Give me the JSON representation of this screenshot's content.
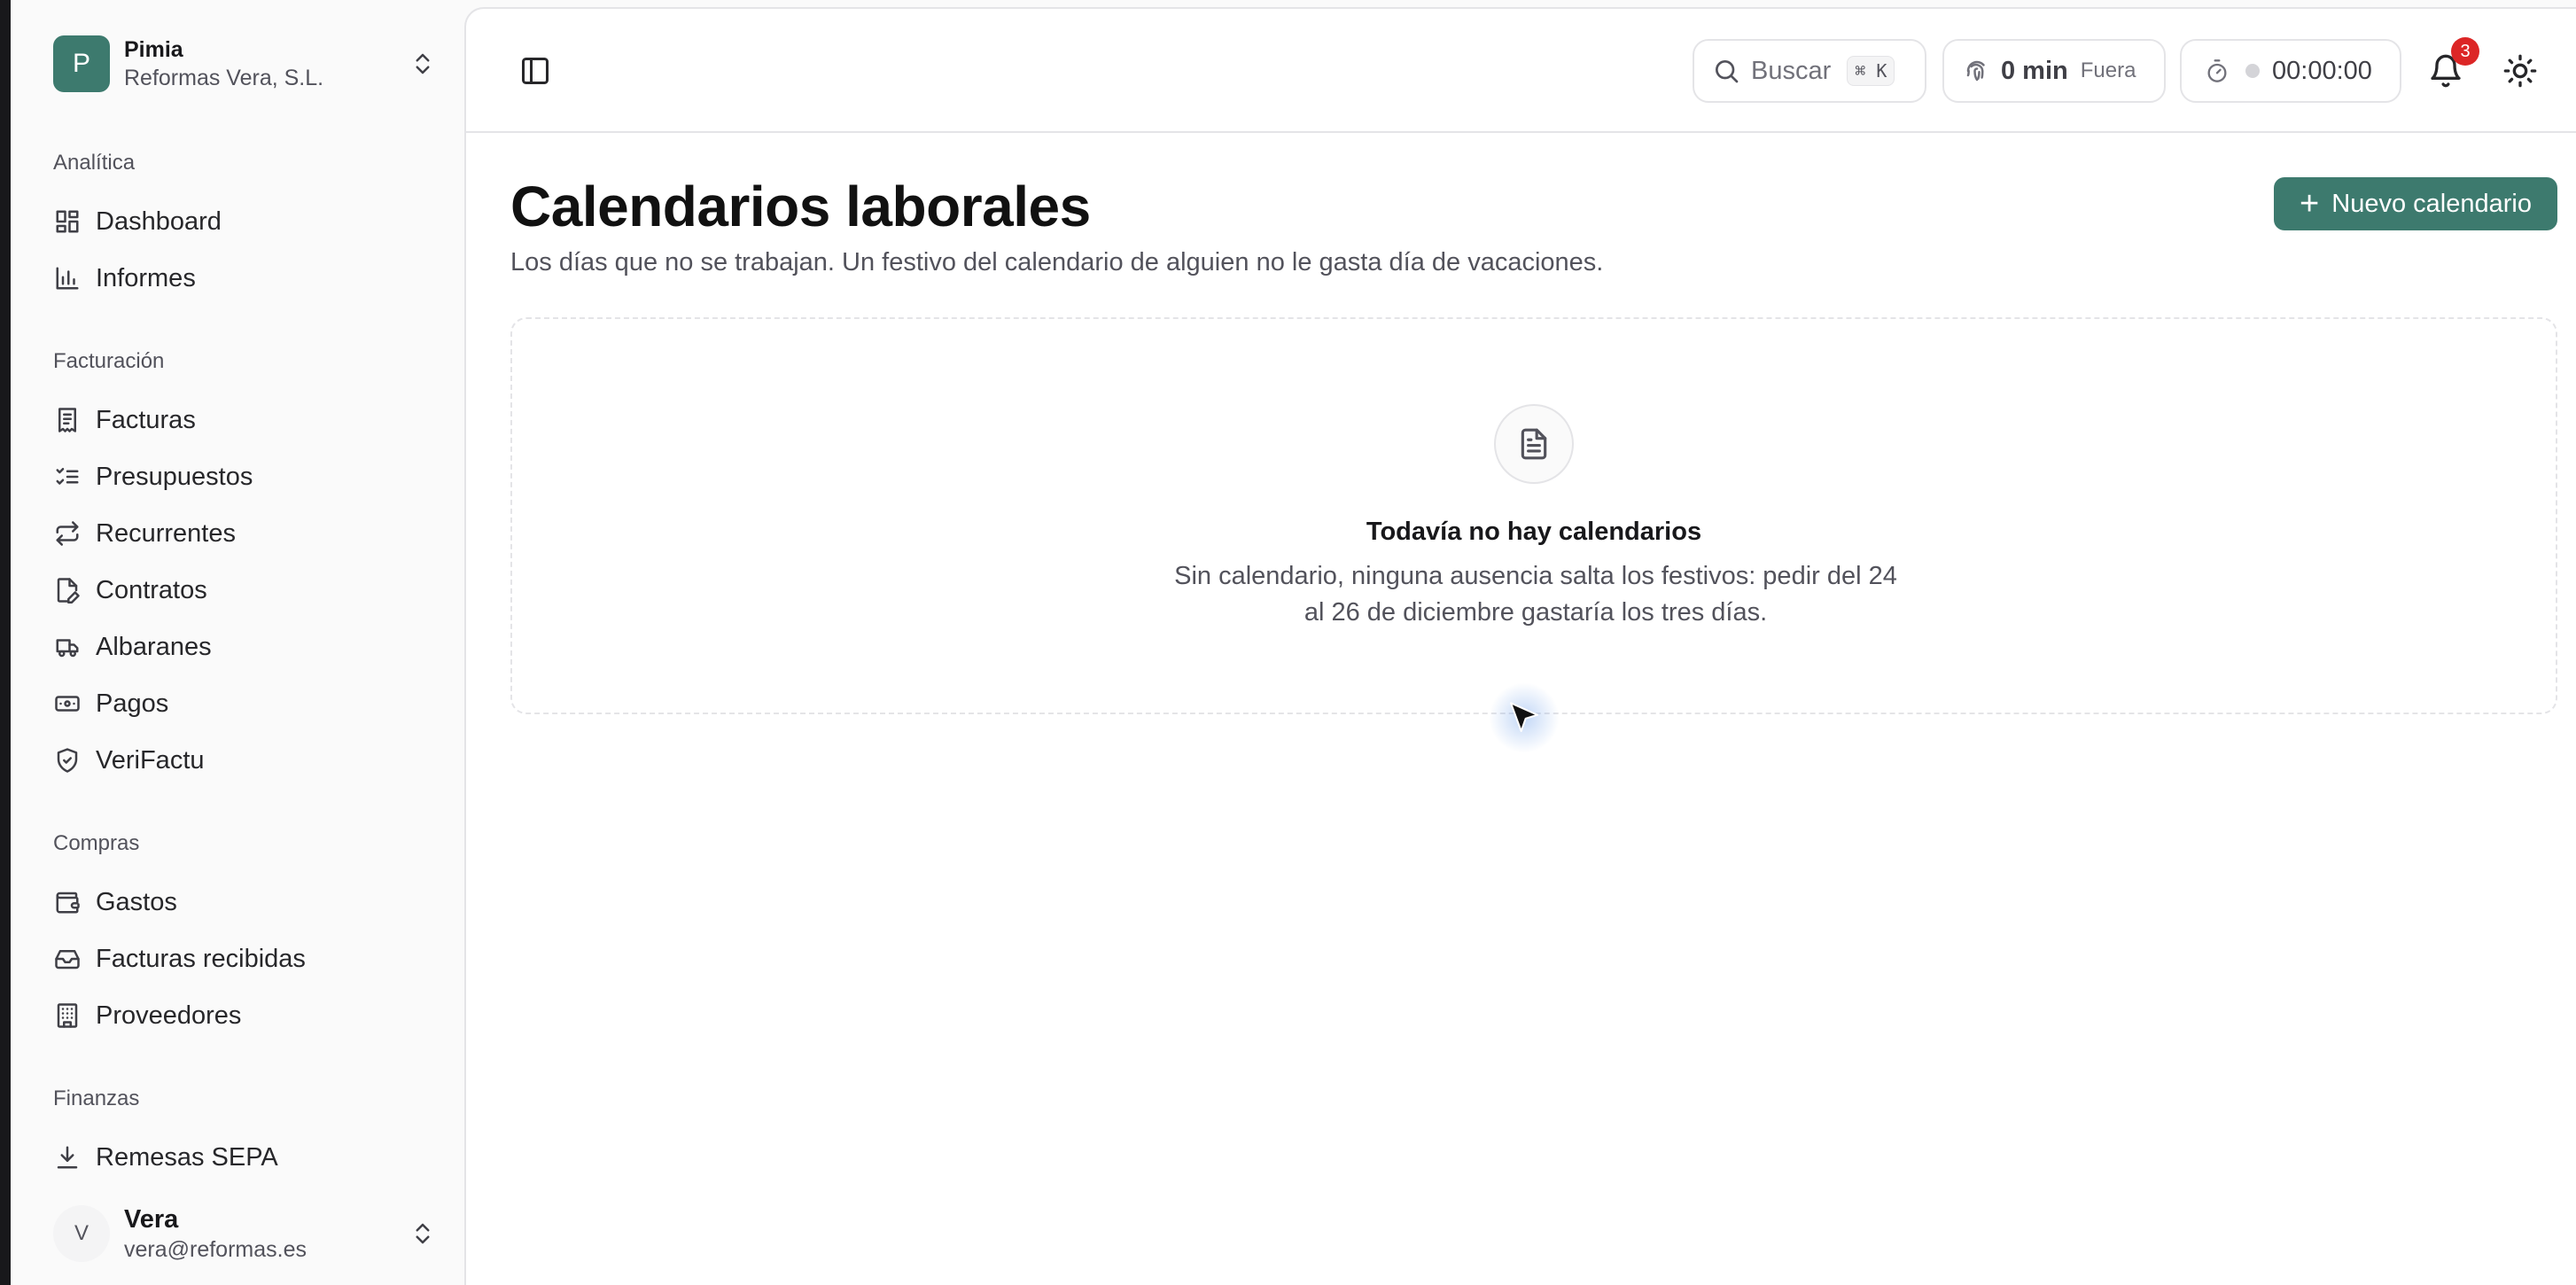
{
  "org": {
    "initial": "P",
    "name": "Pimia",
    "company": "Reformas Vera, S.L."
  },
  "sidebar": {
    "sections": [
      {
        "label": "Analítica",
        "items": [
          {
            "label": "Dashboard",
            "icon": "dashboard-icon"
          },
          {
            "label": "Informes",
            "icon": "bar-chart-icon"
          }
        ]
      },
      {
        "label": "Facturación",
        "items": [
          {
            "label": "Facturas",
            "icon": "receipt-icon"
          },
          {
            "label": "Presupuestos",
            "icon": "checklist-icon"
          },
          {
            "label": "Recurrentes",
            "icon": "repeat-icon"
          },
          {
            "label": "Contratos",
            "icon": "file-pen-icon"
          },
          {
            "label": "Albaranes",
            "icon": "truck-icon"
          },
          {
            "label": "Pagos",
            "icon": "banknote-icon"
          },
          {
            "label": "VeriFactu",
            "icon": "shield-check-icon"
          }
        ]
      },
      {
        "label": "Compras",
        "items": [
          {
            "label": "Gastos",
            "icon": "wallet-icon"
          },
          {
            "label": "Facturas recibidas",
            "icon": "inbox-icon"
          },
          {
            "label": "Proveedores",
            "icon": "building-icon"
          }
        ]
      },
      {
        "label": "Finanzas",
        "items": [
          {
            "label": "Remesas SEPA",
            "icon": "download-icon"
          }
        ]
      }
    ]
  },
  "user": {
    "initial": "V",
    "name": "Vera",
    "email": "vera@reformas.es"
  },
  "topbar": {
    "search_label": "Buscar",
    "search_shortcut": "⌘ K",
    "clock_minutes": "0 min",
    "clock_status": "Fuera",
    "timer": "00:00:00",
    "notifications_count": "3"
  },
  "page": {
    "title": "Calendarios laborales",
    "subtitle": "Los días que no se trabajan. Un festivo del calendario de alguien no le gasta día de vacaciones.",
    "new_button": "Nuevo calendario"
  },
  "empty_state": {
    "title": "Todavía no hay calendarios",
    "description": "Sin calendario, ninguna ausencia salta los festivos: pedir del 24 al 26 de diciembre gastaría los tres días."
  },
  "colors": {
    "accent": "#3d7a6e",
    "badge": "#dc2626"
  }
}
